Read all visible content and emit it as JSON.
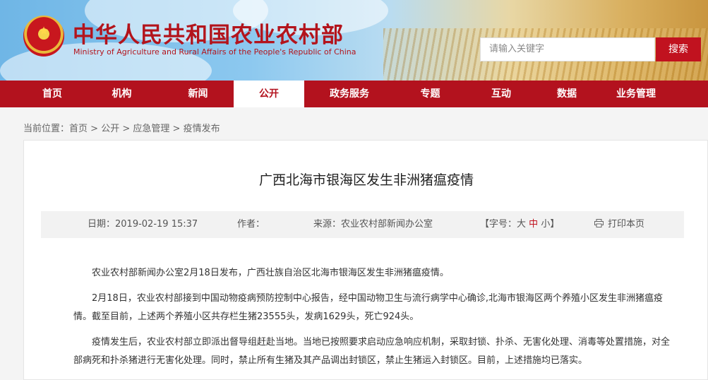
{
  "header": {
    "title": "中华人民共和国农业农村部",
    "subtitle": "Ministry of Agriculture and Rural Affairs of the People's Republic of China",
    "search_placeholder": "请输入关键字",
    "search_button": "搜索"
  },
  "nav": {
    "items": [
      "首页",
      "机构",
      "新闻",
      "公开",
      "政务服务",
      "专题",
      "互动",
      "数据",
      "业务管理"
    ],
    "active": "公开"
  },
  "breadcrumb": {
    "prefix": "当前位置：",
    "items": [
      "首页",
      "公开",
      "应急管理",
      "疫情发布"
    ],
    "separator": " > "
  },
  "article": {
    "title": "广西北海市银海区发生非洲猪瘟疫情",
    "meta": {
      "date_label": "日期：",
      "date": "2019-02-19 15:37",
      "author_label": "作者：",
      "author": "",
      "source_label": "来源：",
      "source": "农业农村部新闻办公室",
      "font_size_label": "【字号：",
      "size_large": "大",
      "size_medium": "中",
      "size_small": "小",
      "font_size_close": "】",
      "print_label": "打印本页"
    },
    "paragraphs": [
      "农业农村部新闻办公室2月18日发布，广西壮族自治区北海市银海区发生非洲猪瘟疫情。",
      "2月18日，农业农村部接到中国动物疫病预防控制中心报告，经中国动物卫生与流行病学中心确诊,北海市银海区两个养殖小区发生非洲猪瘟疫情。截至目前，上述两个养殖小区共存栏生猪23555头，发病1629头，死亡924头。",
      "疫情发生后，农业农村部立即派出督导组赶赴当地。当地已按照要求启动应急响应机制，采取封锁、扑杀、无害化处理、消毒等处置措施，对全部病死和扑杀猪进行无害化处理。同时，禁止所有生猪及其产品调出封锁区，禁止生猪运入封锁区。目前，上述措施均已落实。"
    ]
  },
  "icons": {
    "emblem": "national-emblem-icon",
    "print": "printer-icon"
  },
  "colors": {
    "brand_red": "#b3121e",
    "search_red": "#c1121f"
  }
}
